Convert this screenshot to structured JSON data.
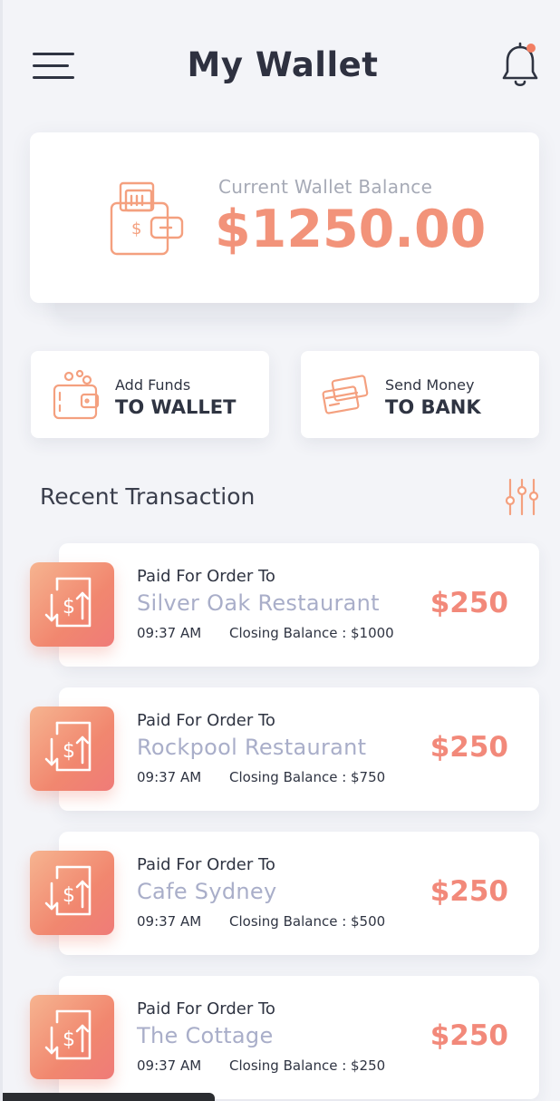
{
  "header": {
    "title": "My Wallet",
    "menu_icon": "hamburger-icon",
    "notification_icon": "bell-icon"
  },
  "balance": {
    "label": "Current Wallet Balance",
    "amount": "$1250.00",
    "icon": "wallet-icon"
  },
  "actions": [
    {
      "small": "Add Funds",
      "big": "TO WALLET",
      "icon": "add-funds-wallet-icon"
    },
    {
      "small": "Send Money",
      "big": "TO BANK",
      "icon": "bank-cards-icon"
    }
  ],
  "recent": {
    "title": "Recent Transaction",
    "filter_icon": "filter-sliders-icon"
  },
  "transactions": [
    {
      "label": "Paid For Order To",
      "name": "Silver Oak Restaurant",
      "time": "09:37 AM",
      "closing": "Closing Balance : $1000",
      "amount": "$250"
    },
    {
      "label": "Paid For Order To",
      "name": "Rockpool Restaurant",
      "time": "09:37 AM",
      "closing": "Closing Balance : $750",
      "amount": "$250"
    },
    {
      "label": "Paid For Order To",
      "name": "Cafe Sydney",
      "time": "09:37 AM",
      "closing": "Closing Balance : $500",
      "amount": "$250"
    },
    {
      "label": "Paid For Order To",
      "name": "The Cottage",
      "time": "09:37 AM",
      "closing": "Closing Balance : $250",
      "amount": "$250"
    }
  ],
  "colors": {
    "accent": "#f2937a",
    "background": "#f3f4f8",
    "muted_name": "#a9aec9"
  }
}
